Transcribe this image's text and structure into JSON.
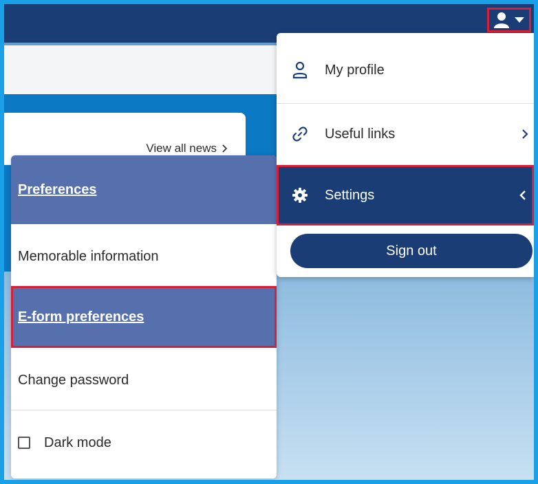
{
  "header": {
    "user_icon": "user-icon",
    "caret_icon": "caret-down-icon"
  },
  "news": {
    "view_all_label": "View all news",
    "chevron_icon": "chevron-right-icon"
  },
  "settings_menu": {
    "items": [
      {
        "label": "Preferences",
        "active": true
      },
      {
        "label": "Memorable information",
        "active": false
      },
      {
        "label": "E-form preferences",
        "active": true
      },
      {
        "label": "Change password",
        "active": false
      }
    ],
    "dark_mode": {
      "label": "Dark mode",
      "checked": false
    }
  },
  "user_menu": {
    "items": [
      {
        "label": "My profile",
        "icon": "person-icon"
      },
      {
        "label": "Useful links",
        "icon": "link-icon"
      },
      {
        "label": "Settings",
        "icon": "gear-icon"
      }
    ],
    "sign_out_label": "Sign out"
  },
  "colors": {
    "navy": "#1a3d75",
    "active_purple": "#5670ad",
    "highlight_red": "#d6203a",
    "brand_blue": "#0b78c3"
  }
}
